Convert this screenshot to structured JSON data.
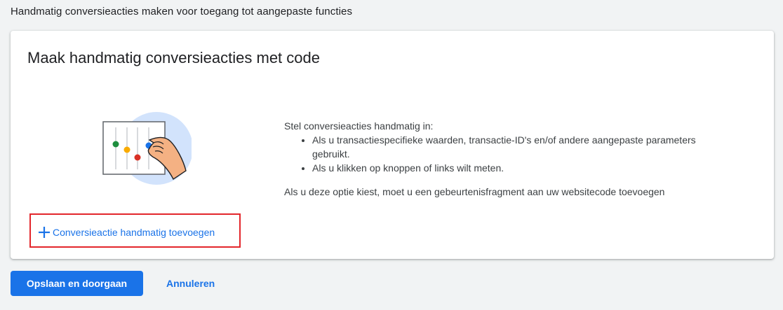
{
  "page": {
    "section_title": "Handmatig conversieacties maken voor toegang tot aangepaste functies"
  },
  "card": {
    "title": "Maak handmatig conversieacties met code",
    "intro": "Stel conversieacties handmatig in:",
    "bullets": [
      "Als u transactiespecifieke waarden, transactie-ID's en/of andere aangepaste parameters gebruikt.",
      "Als u klikken op knoppen of links wilt meten."
    ],
    "note": "Als u deze optie kiest, moet u een gebeurtenisfragment aan uw websitecode toevoegen",
    "add_link_label": "Conversieactie handmatig toevoegen",
    "add_icon": "plus-icon",
    "illustration_icon": "equalizer-hand-illustration"
  },
  "actions": {
    "save_label": "Opslaan en doorgaan",
    "cancel_label": "Annuleren"
  },
  "colors": {
    "accent": "#1a73e8",
    "highlight_border": "#e3262b",
    "background": "#f1f3f4"
  }
}
